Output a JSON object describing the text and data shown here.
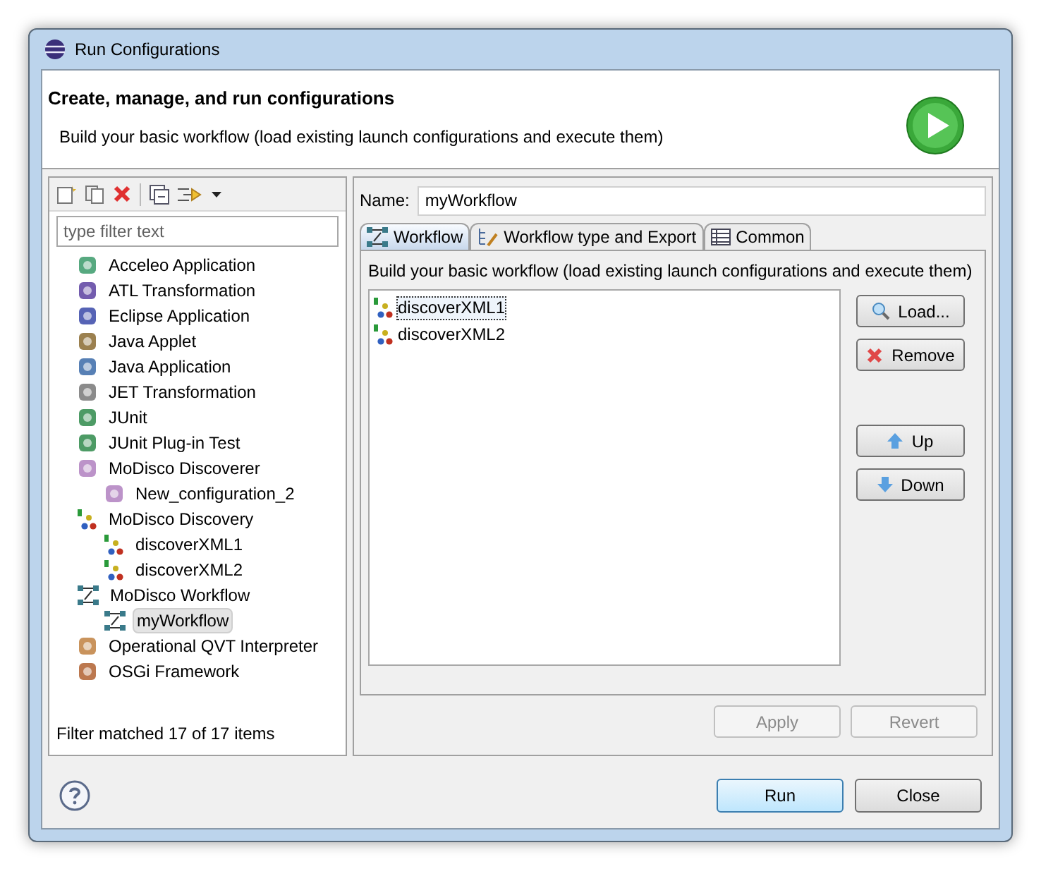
{
  "window": {
    "title": "Run Configurations"
  },
  "header": {
    "title": "Create, manage, and run configurations",
    "subtitle": "Build your basic workflow (load existing launch configurations and execute them)"
  },
  "filter": {
    "placeholder": "type filter text"
  },
  "tree": [
    {
      "label": "Acceleo Application",
      "selected": false
    },
    {
      "label": "ATL Transformation",
      "selected": false
    },
    {
      "label": "Eclipse Application",
      "selected": false
    },
    {
      "label": "Java Applet",
      "selected": false
    },
    {
      "label": "Java Application",
      "selected": false
    },
    {
      "label": "JET Transformation",
      "selected": false
    },
    {
      "label": "JUnit",
      "selected": false
    },
    {
      "label": "JUnit Plug-in Test",
      "selected": false
    },
    {
      "label": "MoDisco Discoverer",
      "selected": false,
      "children": [
        {
          "label": "New_configuration_2",
          "selected": false
        }
      ]
    },
    {
      "label": "MoDisco Discovery",
      "selected": false,
      "children": [
        {
          "label": "discoverXML1",
          "selected": false
        },
        {
          "label": "discoverXML2",
          "selected": false
        }
      ]
    },
    {
      "label": "MoDisco Workflow",
      "selected": false,
      "children": [
        {
          "label": "myWorkflow",
          "selected": true
        }
      ]
    },
    {
      "label": "Operational QVT Interpreter",
      "selected": false
    },
    {
      "label": "OSGi Framework",
      "selected": false
    }
  ],
  "status": "Filter matched 17 of 17 items",
  "name_field": {
    "label": "Name:",
    "value": "myWorkflow"
  },
  "tabs": [
    {
      "label": "Workflow",
      "selected": true
    },
    {
      "label": "Workflow type and Export",
      "selected": false
    },
    {
      "label": "Common",
      "selected": false
    }
  ],
  "description": "Build your basic workflow (load existing launch configurations and execute them)",
  "workflow_items": [
    {
      "label": "discoverXML1",
      "selected": true
    },
    {
      "label": "discoverXML2",
      "selected": false
    }
  ],
  "side_buttons": [
    {
      "label": "Load...",
      "kind": "load"
    },
    {
      "label": "Remove",
      "kind": "remove"
    },
    {
      "label": "Up",
      "kind": "up"
    },
    {
      "label": "Down",
      "kind": "down"
    }
  ],
  "form_buttons": [
    {
      "label": "Apply",
      "disabled": true
    },
    {
      "label": "Revert",
      "disabled": true
    }
  ],
  "dialog_buttons": [
    {
      "label": "Run",
      "default": true
    },
    {
      "label": "Close",
      "default": false
    }
  ]
}
